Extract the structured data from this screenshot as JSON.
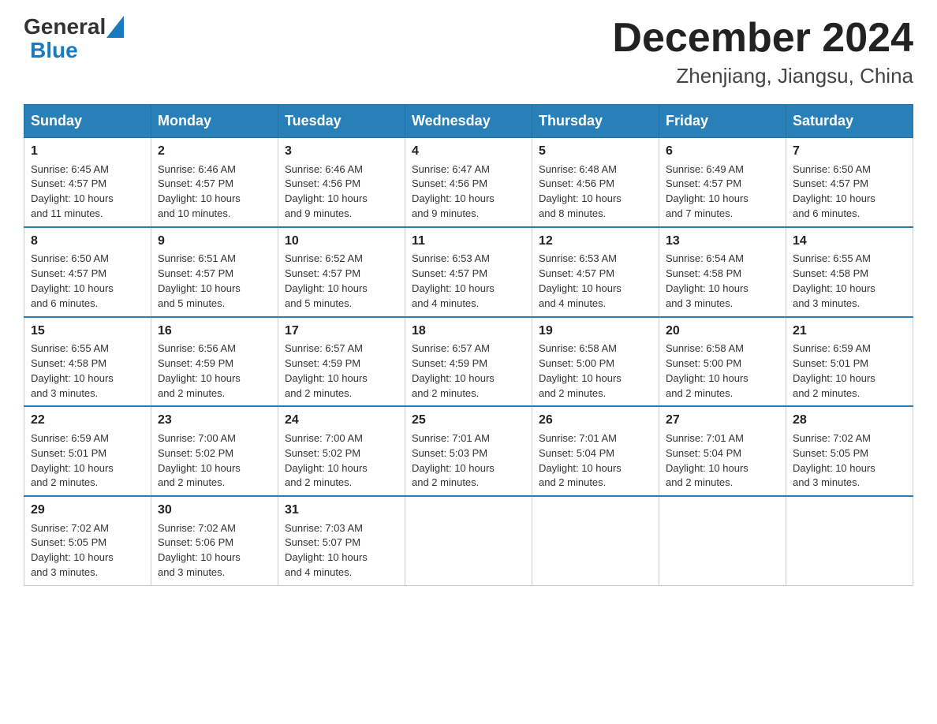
{
  "header": {
    "logo_general": "General",
    "logo_blue": "Blue",
    "month_title": "December 2024",
    "location": "Zhenjiang, Jiangsu, China"
  },
  "weekdays": [
    "Sunday",
    "Monday",
    "Tuesday",
    "Wednesday",
    "Thursday",
    "Friday",
    "Saturday"
  ],
  "weeks": [
    [
      {
        "day": "1",
        "info": "Sunrise: 6:45 AM\nSunset: 4:57 PM\nDaylight: 10 hours\nand 11 minutes."
      },
      {
        "day": "2",
        "info": "Sunrise: 6:46 AM\nSunset: 4:57 PM\nDaylight: 10 hours\nand 10 minutes."
      },
      {
        "day": "3",
        "info": "Sunrise: 6:46 AM\nSunset: 4:56 PM\nDaylight: 10 hours\nand 9 minutes."
      },
      {
        "day": "4",
        "info": "Sunrise: 6:47 AM\nSunset: 4:56 PM\nDaylight: 10 hours\nand 9 minutes."
      },
      {
        "day": "5",
        "info": "Sunrise: 6:48 AM\nSunset: 4:56 PM\nDaylight: 10 hours\nand 8 minutes."
      },
      {
        "day": "6",
        "info": "Sunrise: 6:49 AM\nSunset: 4:57 PM\nDaylight: 10 hours\nand 7 minutes."
      },
      {
        "day": "7",
        "info": "Sunrise: 6:50 AM\nSunset: 4:57 PM\nDaylight: 10 hours\nand 6 minutes."
      }
    ],
    [
      {
        "day": "8",
        "info": "Sunrise: 6:50 AM\nSunset: 4:57 PM\nDaylight: 10 hours\nand 6 minutes."
      },
      {
        "day": "9",
        "info": "Sunrise: 6:51 AM\nSunset: 4:57 PM\nDaylight: 10 hours\nand 5 minutes."
      },
      {
        "day": "10",
        "info": "Sunrise: 6:52 AM\nSunset: 4:57 PM\nDaylight: 10 hours\nand 5 minutes."
      },
      {
        "day": "11",
        "info": "Sunrise: 6:53 AM\nSunset: 4:57 PM\nDaylight: 10 hours\nand 4 minutes."
      },
      {
        "day": "12",
        "info": "Sunrise: 6:53 AM\nSunset: 4:57 PM\nDaylight: 10 hours\nand 4 minutes."
      },
      {
        "day": "13",
        "info": "Sunrise: 6:54 AM\nSunset: 4:58 PM\nDaylight: 10 hours\nand 3 minutes."
      },
      {
        "day": "14",
        "info": "Sunrise: 6:55 AM\nSunset: 4:58 PM\nDaylight: 10 hours\nand 3 minutes."
      }
    ],
    [
      {
        "day": "15",
        "info": "Sunrise: 6:55 AM\nSunset: 4:58 PM\nDaylight: 10 hours\nand 3 minutes."
      },
      {
        "day": "16",
        "info": "Sunrise: 6:56 AM\nSunset: 4:59 PM\nDaylight: 10 hours\nand 2 minutes."
      },
      {
        "day": "17",
        "info": "Sunrise: 6:57 AM\nSunset: 4:59 PM\nDaylight: 10 hours\nand 2 minutes."
      },
      {
        "day": "18",
        "info": "Sunrise: 6:57 AM\nSunset: 4:59 PM\nDaylight: 10 hours\nand 2 minutes."
      },
      {
        "day": "19",
        "info": "Sunrise: 6:58 AM\nSunset: 5:00 PM\nDaylight: 10 hours\nand 2 minutes."
      },
      {
        "day": "20",
        "info": "Sunrise: 6:58 AM\nSunset: 5:00 PM\nDaylight: 10 hours\nand 2 minutes."
      },
      {
        "day": "21",
        "info": "Sunrise: 6:59 AM\nSunset: 5:01 PM\nDaylight: 10 hours\nand 2 minutes."
      }
    ],
    [
      {
        "day": "22",
        "info": "Sunrise: 6:59 AM\nSunset: 5:01 PM\nDaylight: 10 hours\nand 2 minutes."
      },
      {
        "day": "23",
        "info": "Sunrise: 7:00 AM\nSunset: 5:02 PM\nDaylight: 10 hours\nand 2 minutes."
      },
      {
        "day": "24",
        "info": "Sunrise: 7:00 AM\nSunset: 5:02 PM\nDaylight: 10 hours\nand 2 minutes."
      },
      {
        "day": "25",
        "info": "Sunrise: 7:01 AM\nSunset: 5:03 PM\nDaylight: 10 hours\nand 2 minutes."
      },
      {
        "day": "26",
        "info": "Sunrise: 7:01 AM\nSunset: 5:04 PM\nDaylight: 10 hours\nand 2 minutes."
      },
      {
        "day": "27",
        "info": "Sunrise: 7:01 AM\nSunset: 5:04 PM\nDaylight: 10 hours\nand 2 minutes."
      },
      {
        "day": "28",
        "info": "Sunrise: 7:02 AM\nSunset: 5:05 PM\nDaylight: 10 hours\nand 3 minutes."
      }
    ],
    [
      {
        "day": "29",
        "info": "Sunrise: 7:02 AM\nSunset: 5:05 PM\nDaylight: 10 hours\nand 3 minutes."
      },
      {
        "day": "30",
        "info": "Sunrise: 7:02 AM\nSunset: 5:06 PM\nDaylight: 10 hours\nand 3 minutes."
      },
      {
        "day": "31",
        "info": "Sunrise: 7:03 AM\nSunset: 5:07 PM\nDaylight: 10 hours\nand 4 minutes."
      },
      {
        "day": "",
        "info": ""
      },
      {
        "day": "",
        "info": ""
      },
      {
        "day": "",
        "info": ""
      },
      {
        "day": "",
        "info": ""
      }
    ]
  ]
}
